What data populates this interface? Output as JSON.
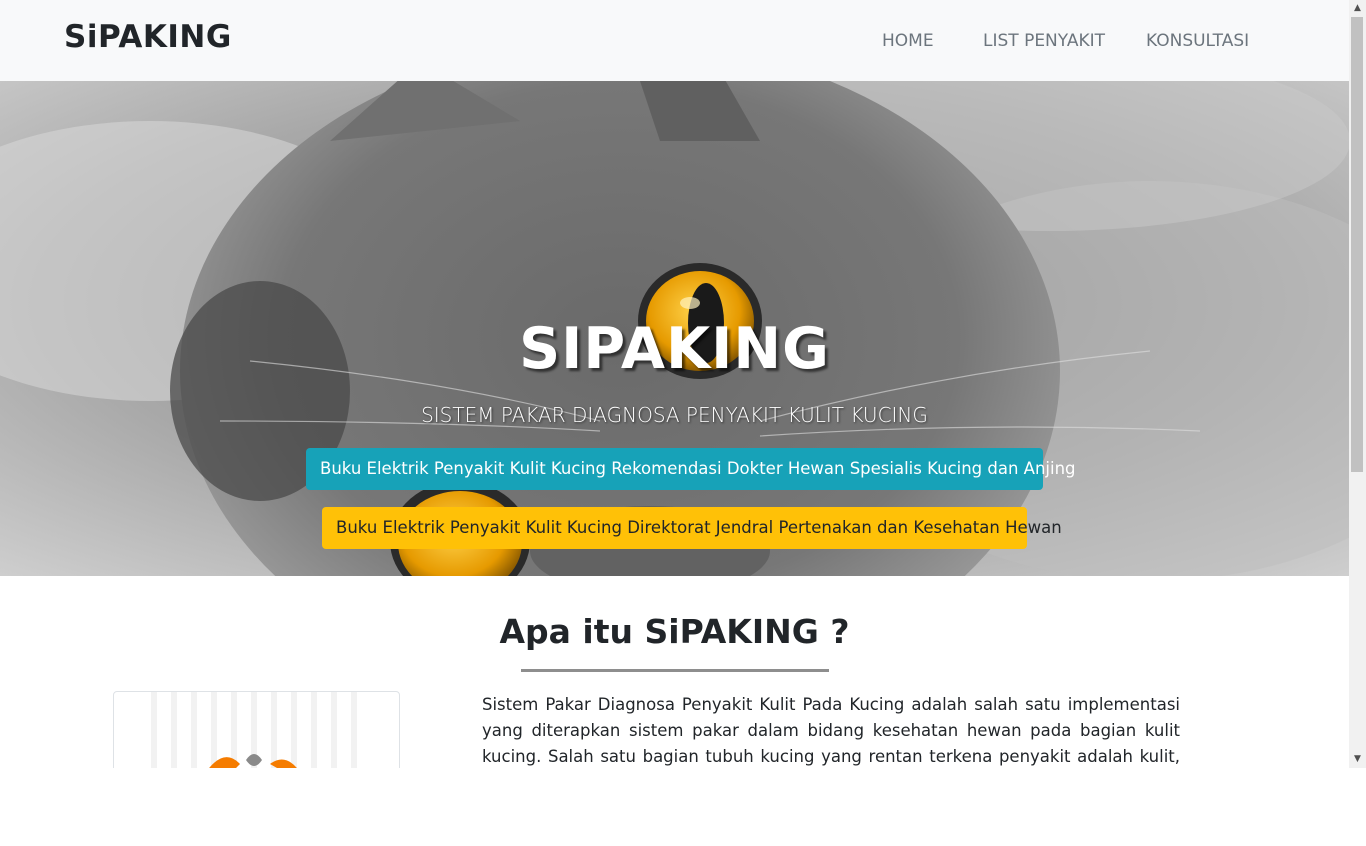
{
  "navbar": {
    "brand": "SiPAKING",
    "links": [
      "HOME",
      "LIST PENYAKIT",
      "KONSULTASI"
    ]
  },
  "hero": {
    "title": "SIPAKING",
    "subtitle": "SISTEM PAKAR DIAGNOSA PENYAKIT KULIT KUCING",
    "button_primary": "Buku Elektrik Penyakit Kulit Kucing Rekomendasi Dokter Hewan Spesialis Kucing dan Anjing",
    "button_secondary": "Buku Elektrik Penyakit Kulit Kucing Direktorat Jendral Pertenakan dan Kesehatan Hewan",
    "image_description_icon": "cat-photo"
  },
  "about": {
    "heading": "Apa itu SiPAKING ?",
    "text": "Sistem Pakar Diagnosa Penyakit Kulit Pada Kucing adalah salah satu implementasi yang diterapkan sistem pakar dalam bidang kesehatan hewan pada bagian kulit kucing. Salah satu bagian tubuh kucing yang rentan terkena penyakit adalah kulit, karena bagian kulit"
  },
  "colors": {
    "info": "#17a2b8",
    "warning": "#ffc107",
    "eye": "#f0a30a",
    "navbar_bg": "#f8f9fa"
  },
  "icons": {
    "scroll_up": "chevron-up-icon",
    "scroll_down": "chevron-down-icon"
  }
}
